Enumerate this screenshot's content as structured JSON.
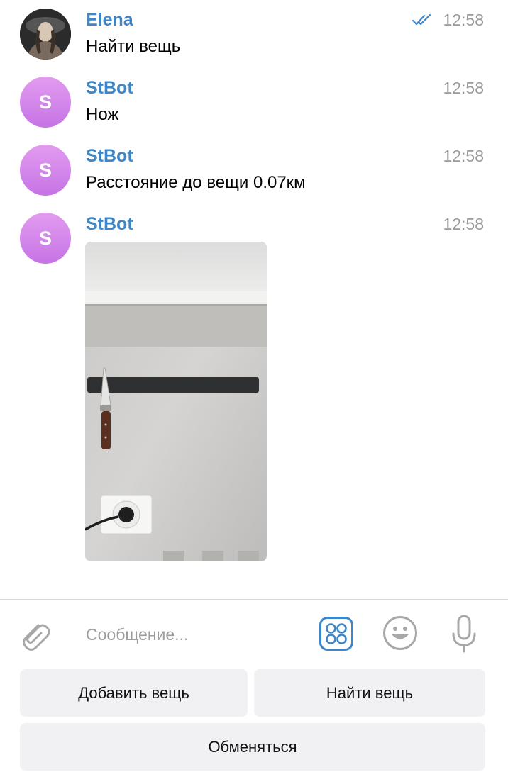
{
  "messages": [
    {
      "sender": "Elena",
      "text": "Найти вещь",
      "time": "12:58",
      "status": "read"
    },
    {
      "sender": "StBot",
      "avatar_letter": "S",
      "text": "Нож",
      "time": "12:58"
    },
    {
      "sender": "StBot",
      "avatar_letter": "S",
      "text": "Расстояние до вещи 0.07км",
      "time": "12:58"
    },
    {
      "sender": "StBot",
      "avatar_letter": "S",
      "time": "12:58",
      "attachment": "photo"
    }
  ],
  "composer": {
    "placeholder": "Сообщение..."
  },
  "keyboard": {
    "add_item": "Добавить вещь",
    "find_item": "Найти вещь",
    "exchange": "Обменяться"
  },
  "colors": {
    "sender": "#3d86c9",
    "accent": "#3d86c9",
    "bot_avatar": "#d08be9",
    "button_bg": "#f1f1f3"
  }
}
